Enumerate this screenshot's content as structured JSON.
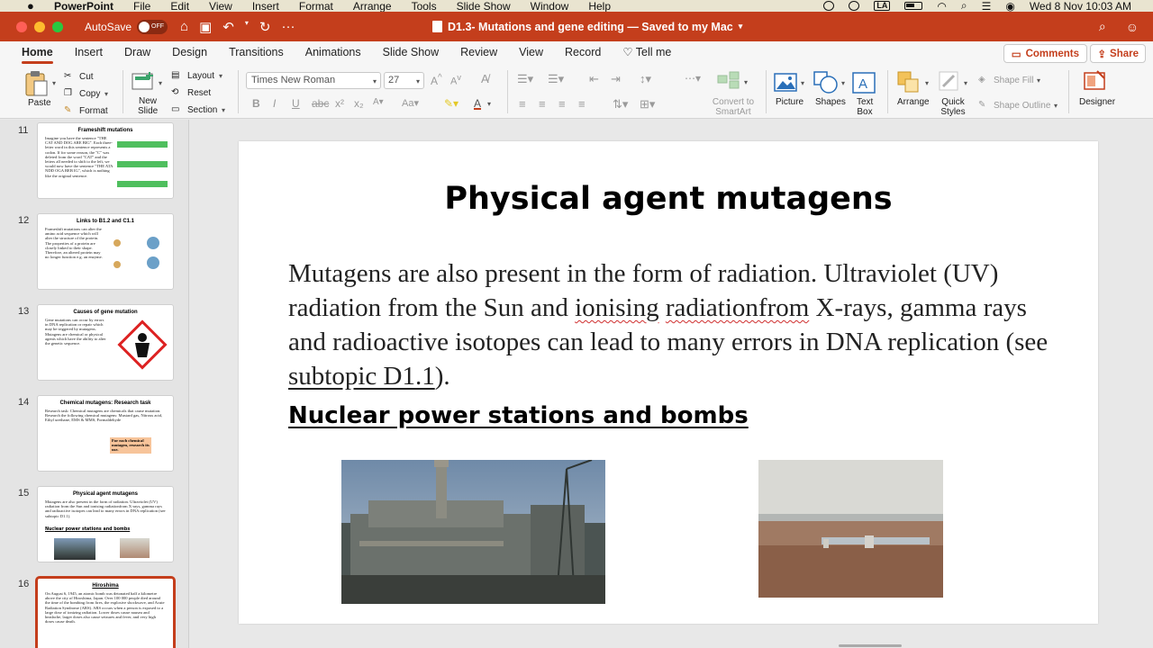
{
  "menubar": {
    "app": "PowerPoint",
    "items": [
      "File",
      "Edit",
      "View",
      "Insert",
      "Format",
      "Arrange",
      "Tools",
      "Slide Show",
      "Window",
      "Help"
    ],
    "keyboard": "LA",
    "clock": "Wed 8 Nov  10:03 AM"
  },
  "titlebar": {
    "autosave_label": "AutoSave",
    "autosave_state": "OFF",
    "document_title": "D1.3- Mutations and gene editing — Saved to my Mac",
    "overflow": "···"
  },
  "ribbon_tabs": [
    "Home",
    "Insert",
    "Draw",
    "Design",
    "Transitions",
    "Animations",
    "Slide Show",
    "Review",
    "View",
    "Record"
  ],
  "tell_me": "Tell me",
  "comments_label": "Comments",
  "share_label": "Share",
  "ribbon": {
    "paste": "Paste",
    "cut": "Cut",
    "copy": "Copy",
    "format": "Format",
    "new_slide": "New Slide",
    "layout": "Layout",
    "reset": "Reset",
    "section": "Section",
    "font_name": "Times New Roman",
    "font_size": "27",
    "convert_smartart": "Convert to SmartArt",
    "picture": "Picture",
    "shapes": "Shapes",
    "text_box": "Text Box",
    "arrange": "Arrange",
    "quick_styles": "Quick Styles",
    "shape_fill": "Shape Fill",
    "shape_outline": "Shape Outline",
    "designer": "Designer"
  },
  "thumbnails": [
    {
      "number": "11",
      "title": "Frameshift mutations",
      "body": "Imagine you have the sentence \"THE CAT AND DOG ARE BIG\". Each three-letter word in this sentence represents a codon. If for some reason, the \"C\" was deleted from the word \"CAT\" and the letters all needed to shift to the left, we would now have the sentence \"THE ATA NDD OGA REB IG\", which is nothing like the original sentence."
    },
    {
      "number": "12",
      "title": "Links to B1.2 and C1.1",
      "body": "Frameshift mutations can alter the amino acid sequence which will alter the structure of the protein. The properties of a protein are closely linked to their shape. Therefore, an altered protein may no longer function e.g. an enzyme."
    },
    {
      "number": "13",
      "title": "Causes of gene mutation",
      "body": "Gene mutations can occur by errors in DNA replication or repair which may be triggered by mutagens. Mutagens are chemical or physical agents which have the ability to alter the genetic sequence."
    },
    {
      "number": "14",
      "title": "Chemical mutagens: Research task",
      "body": "Research task: Chemical mutagens are chemicals that cause mutation. Research the following chemical mutagens: Mustard gas, Nitrous acid, Ethyl urethane, EMS & MMS, Formaldehyde",
      "callout": "For each chemical mutagen, research its use."
    },
    {
      "number": "15",
      "title": "Physical agent mutagens",
      "body": "Mutagens are also present in the form of radiation. Ultraviolet (UV) radiation from the Sun and ionising radiationfrom X-rays, gamma rays and radioactive isotopes can lead to many errors in DNA replication (see subtopic D1.1).",
      "subhead": "Nuclear power stations and bombs"
    },
    {
      "number": "16",
      "title": "Hiroshima",
      "body": "On August 6, 1945, an atomic bomb was detonated half a kilometre above the city of Hiroshima, Japan. Over 100 000 people died around the time of the bombing from fires, the explosive shockwave, and Acute Radiation Syndrome (ARS). ARS occurs when a person is exposed to a large dose of ionizing radiation. Lower doses cause nausea and headache, larger doses also cause seizures and fever, and very high doses cause death."
    }
  ],
  "slide": {
    "title": "Physical agent mutagens",
    "body_part1": "Mutagens are also present in the form of radiation. Ultraviolet (UV) radiation from the Sun and ",
    "body_squiggle1": "ionising",
    "body_space": " ",
    "body_squiggle2": "radiationfrom",
    "body_part2": " X-rays, gamma rays and radioactive isotopes can lead to many errors in DNA replication (see ",
    "body_link": "subtopic D1.1",
    "body_part3": ").",
    "subheading": "Nuclear power stations and bombs"
  }
}
